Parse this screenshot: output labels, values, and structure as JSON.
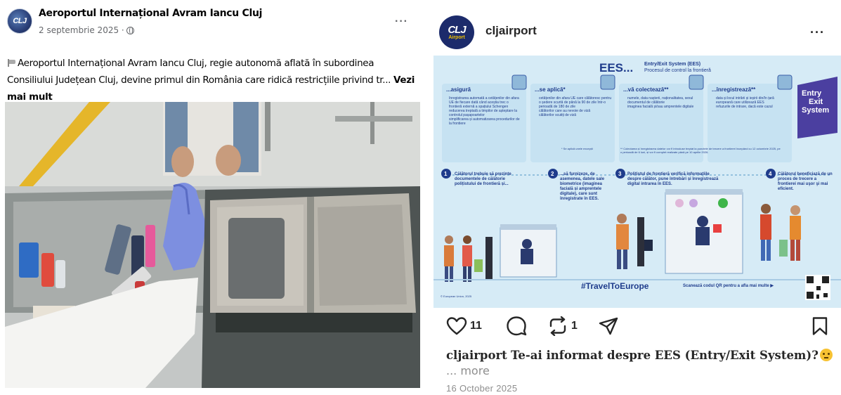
{
  "facebook": {
    "page_name": "Aeroportul Internațional Avram Iancu Cluj",
    "avatar_text": "CLJ",
    "date": "2 septembrie 2025 ·",
    "more_menu": "···",
    "post_text": "Aeroportul Internațional Avram Iancu Cluj, regie autonomă aflată în subordinea Consiliului Județean Cluj, devine primul din România care ridică restricțiile privind tr...",
    "see_more": "Vezi mai mult"
  },
  "instagram": {
    "username": "cljairport",
    "avatar_line1": "CLJ",
    "avatar_line2": "Airport",
    "more_menu": "···",
    "likes_count": "11",
    "reposts_count": "1",
    "caption_user": "cljairport",
    "caption_text": "Te-ai informat despre EES (Entry/Exit System)?",
    "caption_more": "... more",
    "date": "16 October 2025",
    "infographic": {
      "title": "EES...",
      "subtitle_1": "Entry/Exit System (EES)",
      "subtitle_2": "Procesul de control la frontieră",
      "badge_1": "Entry",
      "badge_2": "Exit",
      "badge_3": "System",
      "col1_head": "...asigură",
      "col1_items": [
        "înregistrarea automată a cetățenilor din afara UE de fiecare dată când aceștia trec o frontieră externă a spațiului Schengen",
        "reducerea treptată a timpilor de așteptare la controlul pașapoartelor",
        "simplificarea și automatizarea procedurilor de la frontiere"
      ],
      "col2_head": "...se aplică*",
      "col2_items": [
        "cetățenilor din afara UE care călătoresc pentru o ședere scurtă de până la 90 de zile într-o perioadă de 180 de zile",
        "călătorilor care au nevoie de viză",
        "călătorilor scutiți de viză"
      ],
      "col3_head": "...vă colectează**",
      "col3_items": [
        "numele, data nașterii, naționalitatea, sexul",
        "documentul de călătorie",
        "imaginea facială și/sau amprentele digitale"
      ],
      "col4_head": "...înregistrează**",
      "col4_items": [
        "data și locul intrării și ieșirii din/în țară europeană care utilizează EES",
        "refuzurile de intrare, dacă este cazul"
      ],
      "note_1": "* Se aplică unele excepții",
      "note_2": "** Colectarea și înregistrarea datelor vor fi introduse treptat la punctele de trecere a frontierei începând cu 12 octombrie 2025, pe o perioadă de 6 luni, și vor fi complet realizate până pe 10 aprilie 2026.",
      "step1_num": "1",
      "step1_text": "Călătorul trebuie să prezinte documentele de călătorie polițistului de frontieră și...",
      "step2_num": "2",
      "step2_text": "...să furnizeze, de asemenea, datele sale biometrice (imaginea facială și amprentele digitale), care sunt înregistrate în EES.",
      "step3_num": "3",
      "step3_text": "Polițistul de frontieră verifică informațiile despre călător, pune întrebări și înregistrează digital intrarea în EES.",
      "step4_num": "4",
      "step4_text": "Călătorul beneficiază de un proces de trecere a frontierei mai uşor şi mai eficient.",
      "hashtag": "#TravelToEurope",
      "qr_text": "Scanează codul QR pentru a afla mai multe ▶",
      "copyright": "© European Union, 2025"
    }
  },
  "colors": {
    "fb_text": "#050505",
    "fb_meta": "#65676b",
    "ig_text": "#262626",
    "ig_muted": "#8e8e8e",
    "infographic_bg": "#d9ecf7",
    "infographic_navy": "#1f3c8c",
    "badge_purple": "#4b3fa0"
  },
  "icons": [
    "globe-icon",
    "heart-icon",
    "comment-icon",
    "repost-icon",
    "share-icon",
    "bookmark-icon",
    "qr-code-icon"
  ]
}
